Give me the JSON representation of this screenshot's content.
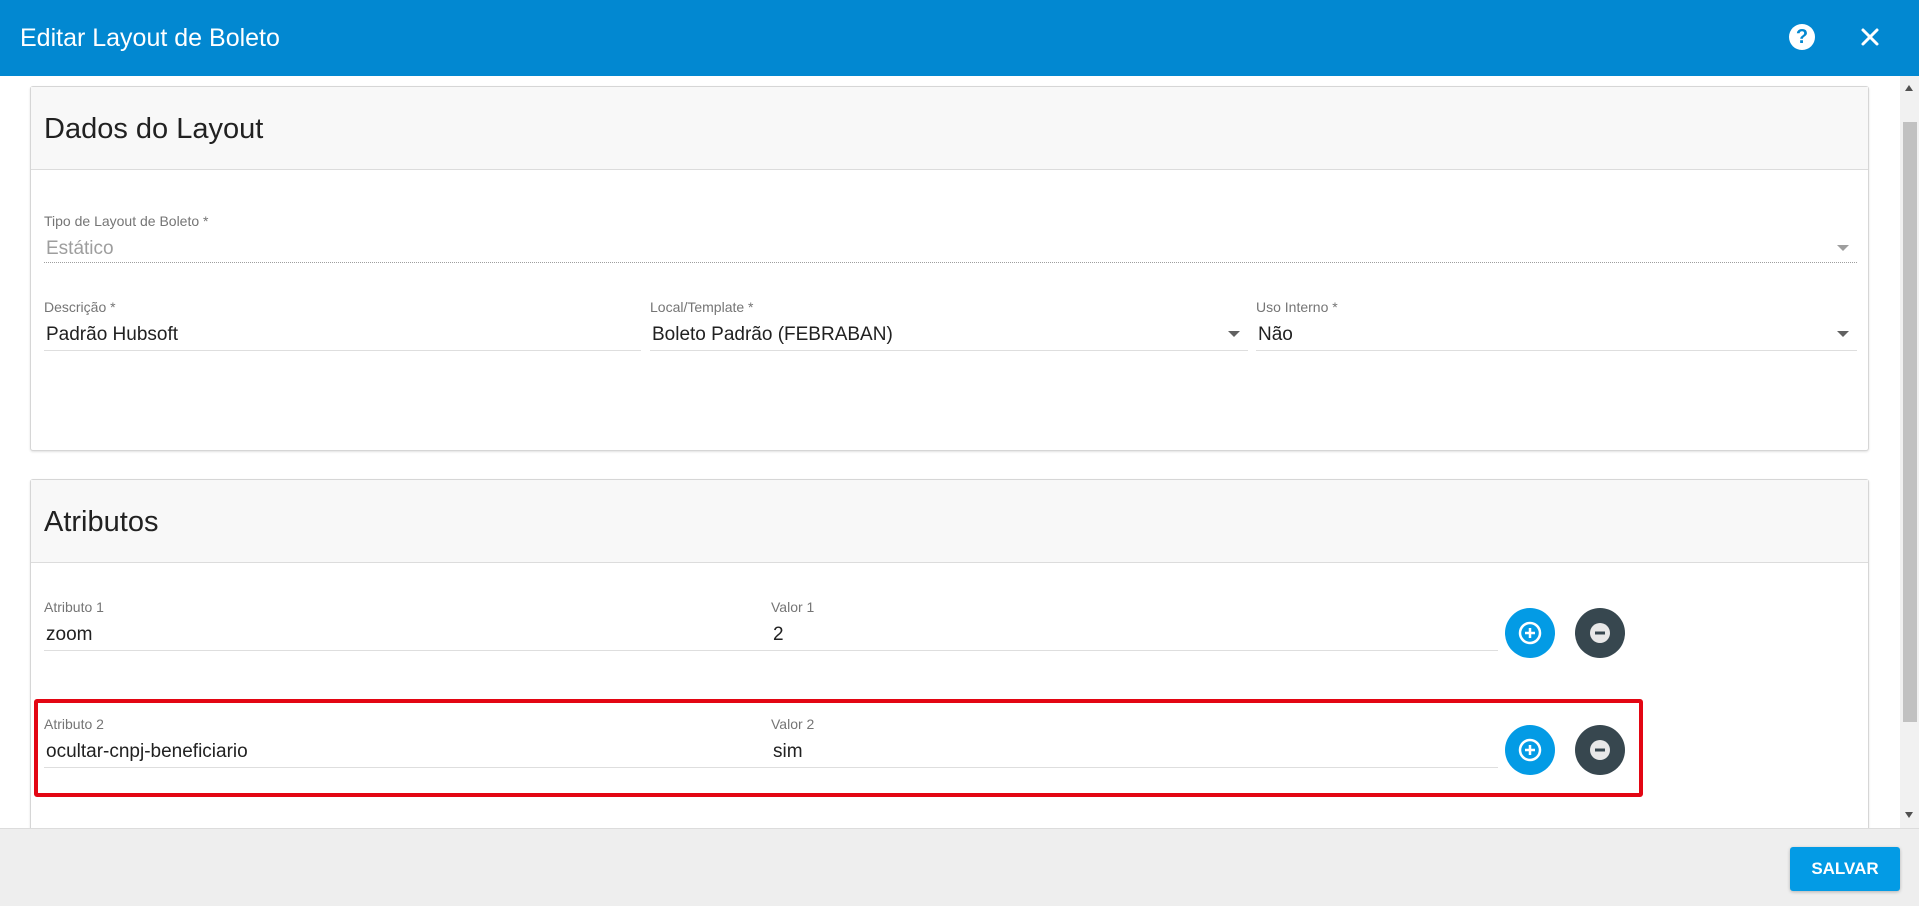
{
  "dialog": {
    "title": "Editar Layout de Boleto",
    "help_icon": "help-circle-icon",
    "close_icon": "close-icon",
    "help_glyph": "?"
  },
  "dados_layout": {
    "title": "Dados do Layout",
    "tipo": {
      "label": "Tipo de Layout de Boleto *",
      "value": "Estático"
    },
    "descricao": {
      "label": "Descrição *",
      "value": "Padrão Hubsoft"
    },
    "local_template": {
      "label": "Local/Template *",
      "value": "Boleto Padrão (FEBRABAN)"
    },
    "uso_interno": {
      "label": "Uso Interno *",
      "value": "Não"
    }
  },
  "atributos": {
    "title": "Atributos",
    "rows": [
      {
        "attr_label": "Atributo 1",
        "attr_value": "zoom",
        "val_label": "Valor 1",
        "val_value": "2"
      },
      {
        "attr_label": "Atributo 2",
        "attr_value": "ocultar-cnpj-beneficiario",
        "val_label": "Valor 2",
        "val_value": "sim"
      }
    ]
  },
  "footer": {
    "save_label": "SALVAR"
  },
  "colors": {
    "primary": "#0288d1",
    "accent_button": "#039be5",
    "dark_button": "#37474f",
    "highlight": "#e30613"
  }
}
